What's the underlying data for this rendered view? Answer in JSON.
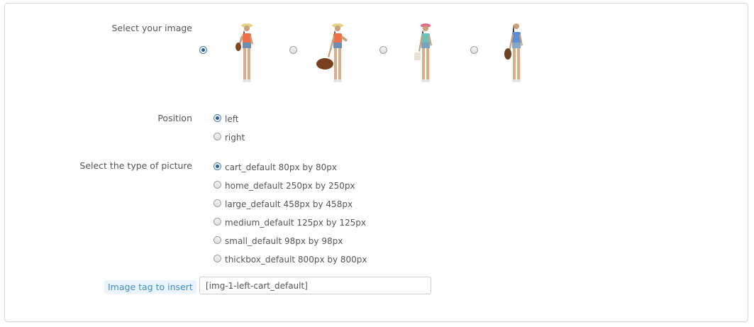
{
  "form": {
    "select_image_label": "Select your image",
    "images": [
      {
        "name": "model-1",
        "checked": true
      },
      {
        "name": "model-2",
        "checked": false
      },
      {
        "name": "model-3",
        "checked": false
      },
      {
        "name": "model-4",
        "checked": false
      }
    ],
    "position_label": "Position",
    "position_options": [
      {
        "label": "left",
        "checked": true
      },
      {
        "label": "right",
        "checked": false
      }
    ],
    "picture_type_label": "Select the type of picture",
    "picture_types": [
      {
        "label": "cart_default 80px by 80px",
        "checked": true
      },
      {
        "label": "home_default 250px by 250px",
        "checked": false
      },
      {
        "label": "large_default 458px by 458px",
        "checked": false
      },
      {
        "label": "medium_default 125px by 125px",
        "checked": false
      },
      {
        "label": "small_default 98px by 98px",
        "checked": false
      },
      {
        "label": "thickbox_default 800px by 800px",
        "checked": false
      }
    ],
    "image_tag_label": "Image tag to insert",
    "image_tag_value": "[img-1-left-cart_default]"
  },
  "colors": {
    "accent": "#2e5f8c",
    "tag_label_bg": "#eaf5fb",
    "tag_label_text": "#3a8dbf",
    "border": "#d3d8db"
  }
}
